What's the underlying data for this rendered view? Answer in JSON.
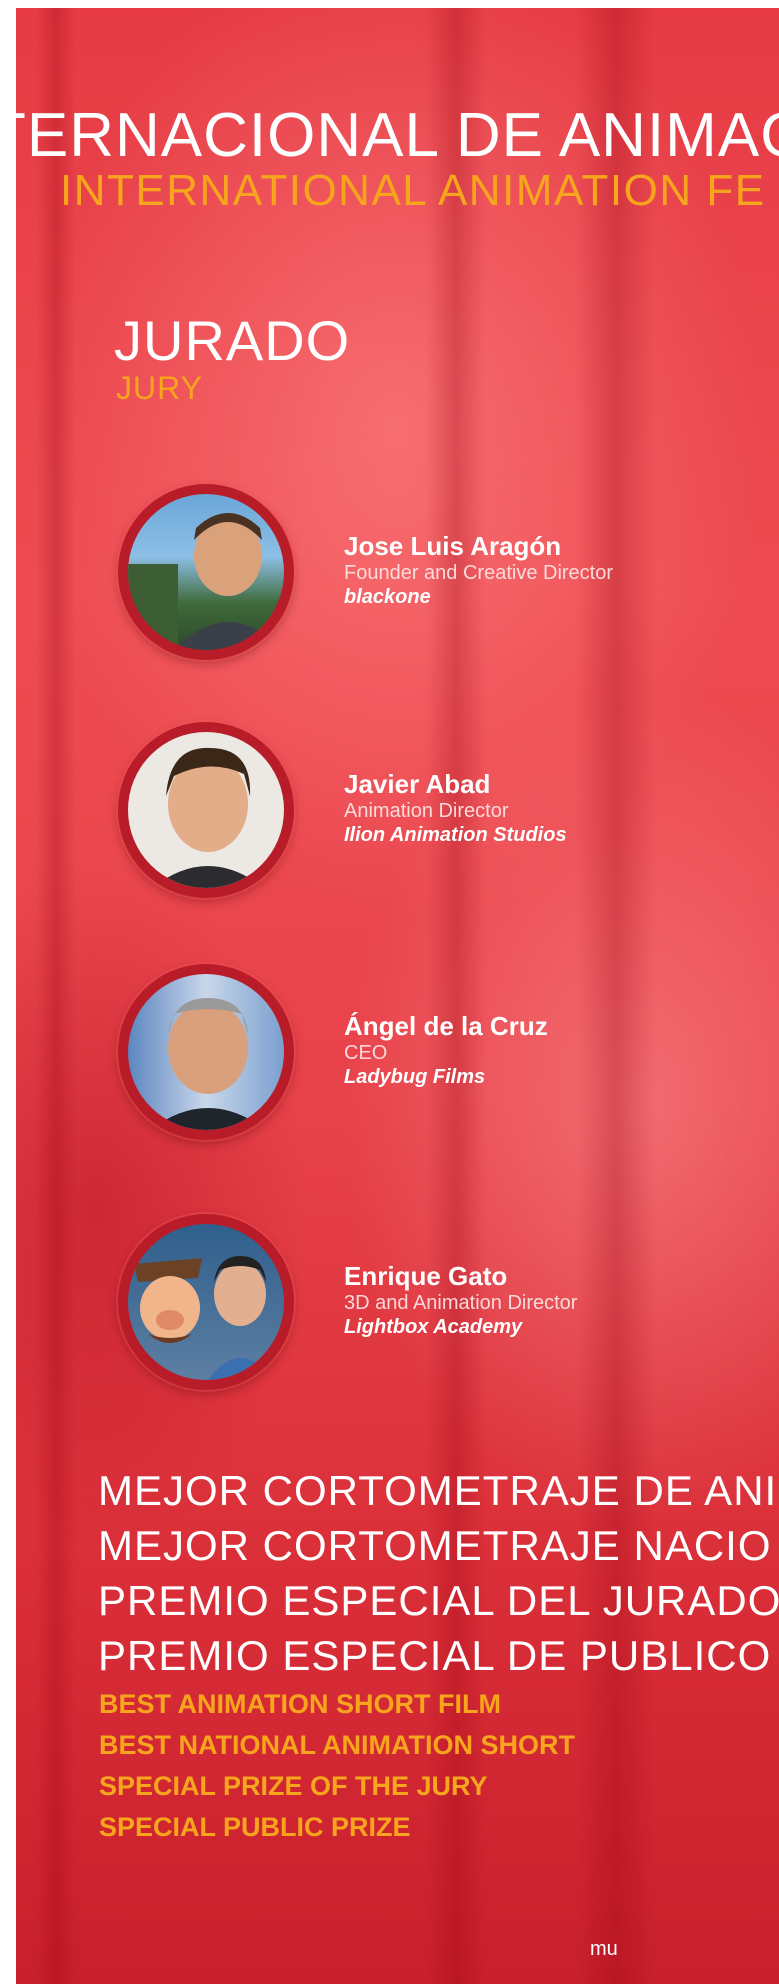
{
  "header": {
    "title_es": "TERNACIONAL DE ANIMAC",
    "title_en": "INTERNATIONAL ANIMATION FE"
  },
  "jury_section": {
    "heading_es": "JURADO",
    "heading_en": "JURY"
  },
  "jury": [
    {
      "name": "Jose Luis Aragón",
      "role": "Founder and Creative Director",
      "company": "blackone"
    },
    {
      "name": "Javier Abad",
      "role": "Animation Director",
      "company": "Ilion Animation Studios"
    },
    {
      "name": "Ángel de la Cruz",
      "role": "CEO",
      "company": "Ladybug Films"
    },
    {
      "name": "Enrique Gato",
      "role": "3D and Animation Director",
      "company": "Lightbox Academy"
    }
  ],
  "awards_es": [
    "MEJOR CORTOMETRAJE DE ANI",
    "MEJOR CORTOMETRAJE NACIO",
    "PREMIO ESPECIAL DEL JURADO",
    "PREMIO ESPECIAL DE PUBLICO"
  ],
  "awards_en": [
    "BEST ANIMATION SHORT FILM",
    "BEST NATIONAL ANIMATION SHORT",
    "SPECIAL PRIZE OF THE JURY",
    "SPECIAL PUBLIC PRIZE"
  ],
  "footer_text": "mu",
  "colors": {
    "background": "#e8424a",
    "accent": "#f7a51c",
    "text": "#ffffff",
    "ring": "#b71c28"
  }
}
